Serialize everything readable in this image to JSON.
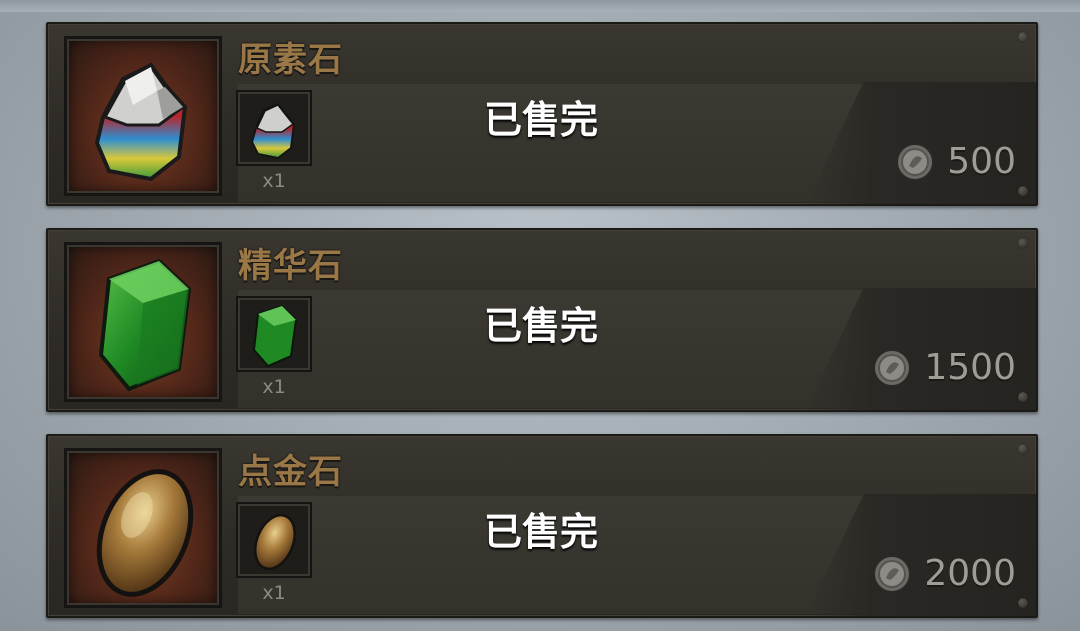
{
  "shop": {
    "items": [
      {
        "name": "原素石",
        "icon": "element-stone-icon",
        "quantity": "x1",
        "status": "已售完",
        "price": "500",
        "currency_icon": "silver-coin-icon"
      },
      {
        "name": "精华石",
        "icon": "essence-stone-icon",
        "quantity": "x1",
        "status": "已售完",
        "price": "1500",
        "currency_icon": "silver-coin-icon"
      },
      {
        "name": "点金石",
        "icon": "gold-touch-stone-icon",
        "quantity": "x1",
        "status": "已售完",
        "price": "2000",
        "currency_icon": "silver-coin-icon"
      }
    ]
  },
  "colors": {
    "title": "#9a7746",
    "sold_out_text": "#ffffff",
    "price_text": "#9f9d96",
    "card_bg": "#2f2c27",
    "page_bg": "#a7b0b7"
  }
}
